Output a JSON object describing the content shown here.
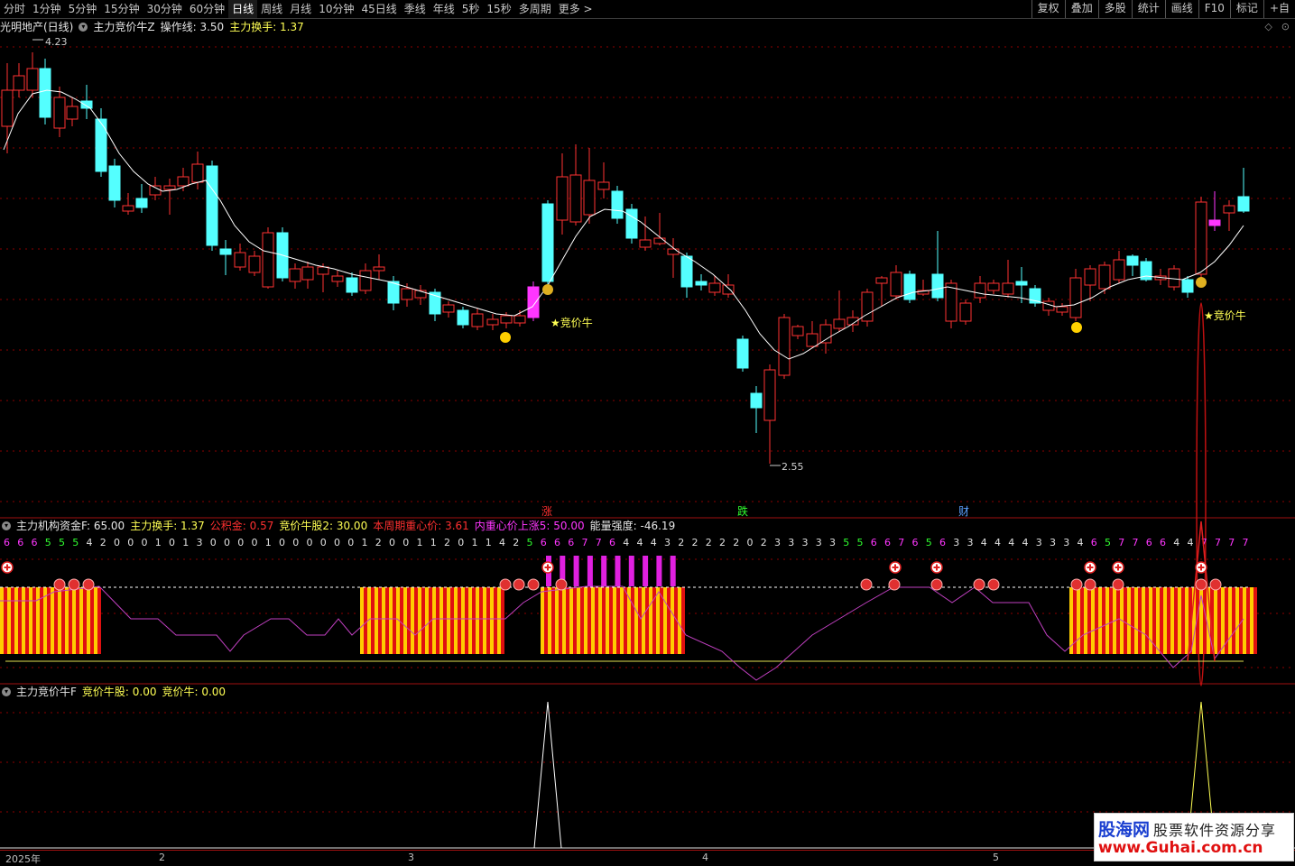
{
  "toolbar": {
    "tabs": [
      "分时",
      "1分钟",
      "5分钟",
      "15分钟",
      "30分钟",
      "60分钟",
      "日线",
      "周线",
      "月线",
      "10分钟",
      "45日线",
      "季线",
      "年线",
      "5秒",
      "15秒",
      "多周期",
      "更多 >"
    ],
    "active_tab": "日线",
    "right_buttons": [
      "复权",
      "叠加",
      "多股",
      "统计",
      "画线",
      "F10",
      "标记",
      "+自"
    ]
  },
  "main_pane": {
    "stock_title": "光明地产(日线)",
    "indicator_name": "主力竞价牛Z",
    "op_line_label": "操作线: 3.50",
    "turnover_label": "主力换手: 1.37",
    "high_label": "4.23",
    "low_label": "2.55",
    "signal_label": "★竞价牛",
    "event_tags": [
      "涨",
      "跌",
      "财"
    ],
    "colors": {
      "up": "#ff3232",
      "down": "#54ffff",
      "ma": "#ffffff",
      "signal": "#ff36ff"
    }
  },
  "sub_pane1": {
    "name": "主力机构资金F",
    "value": ": 65.00",
    "turnover": "主力换手: 1.37",
    "fund": "公积金: 0.57",
    "bull2": "竞价牛股2: 30.00",
    "week_center": "本周期重心价: 3.61",
    "inner_center": "内重心价上涨5: 50.00",
    "energy": "能量强度: -46.19",
    "digits": [
      "6",
      "6",
      "6",
      "5",
      "5",
      "5",
      "4",
      "2",
      "0",
      "0",
      "0",
      "1",
      "0",
      "1",
      "3",
      "0",
      "0",
      "0",
      "0",
      "1",
      "0",
      "0",
      "0",
      "0",
      "0",
      "0",
      "1",
      "2",
      "0",
      "0",
      "1",
      "1",
      "2",
      "0",
      "1",
      "1",
      "4",
      "2",
      "5",
      "6",
      "6",
      "6",
      "7",
      "7",
      "6",
      "4",
      "4",
      "4",
      "3",
      "2",
      "2",
      "2",
      "2",
      "2",
      "0",
      "2",
      "3",
      "3",
      "3",
      "3",
      "3",
      "5",
      "5",
      "6",
      "6",
      "7",
      "6",
      "5",
      "6",
      "3",
      "3",
      "4",
      "4",
      "4",
      "4",
      "3",
      "3",
      "3",
      "4",
      "6",
      "5",
      "7",
      "7",
      "6",
      "6",
      "4",
      "4",
      "7",
      "7",
      "7",
      "7"
    ]
  },
  "sub_pane2": {
    "name": "主力竞价牛F",
    "bull_stock": "竞价牛股: 0.00",
    "bull": "竞价牛: 0.00"
  },
  "x_axis": {
    "labels": [
      "2025年",
      "2",
      "3",
      "4",
      "5"
    ]
  },
  "watermark": {
    "brand": "股海网",
    "slogan": "股票软件资源分享",
    "url": "www.Guhai.com.cn"
  }
}
